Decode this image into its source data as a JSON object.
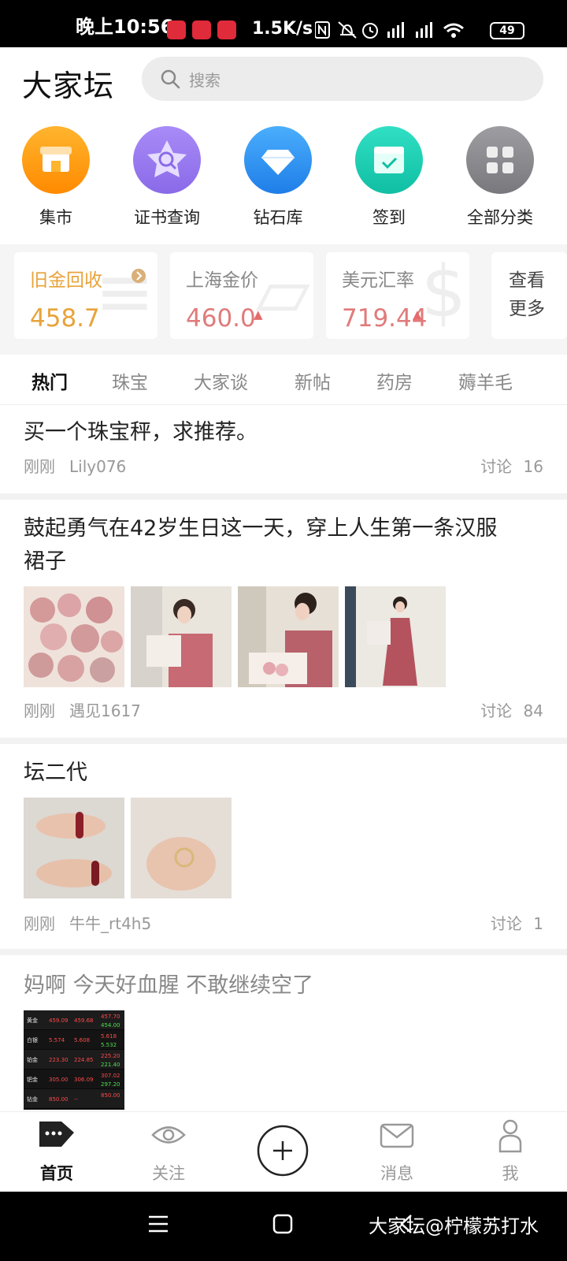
{
  "status_bar": {
    "time": "晚上10:56",
    "speed": "1.5K/s",
    "battery": "49",
    "icons": [
      "nfc-icon",
      "mute-icon",
      "alarm-icon",
      "signal-icon",
      "signal-icon",
      "wifi-icon"
    ]
  },
  "header": {
    "logo": "大家坛",
    "search_placeholder": "搜索"
  },
  "categories": [
    {
      "label": "集市",
      "icon": "shop-icon",
      "color": "#ff9f1c"
    },
    {
      "label": "证书查询",
      "icon": "certificate-search-icon",
      "color": "#9a7cf2"
    },
    {
      "label": "钻石库",
      "icon": "diamond-icon",
      "color": "#2b93f0"
    },
    {
      "label": "签到",
      "icon": "calendar-check-icon",
      "color": "#1ccfb4"
    },
    {
      "label": "全部分类",
      "icon": "grid-icon",
      "color": "#8c8c90"
    }
  ],
  "tickers": [
    {
      "name": "旧金回收",
      "value": "458.7",
      "value_color": "#e8a33a",
      "has_link": true
    },
    {
      "name": "上海金价",
      "value": "460.0",
      "value_color": "#e07b7b",
      "trend": "up"
    },
    {
      "name": "美元汇率",
      "value": "719.44",
      "value_color": "#e07b7b",
      "trend": "up"
    }
  ],
  "more_label": "查看更多",
  "more_line1": "查看",
  "more_line2": "更多",
  "tabs": [
    "热门",
    "珠宝",
    "大家谈",
    "新帖",
    "药房",
    "薅羊毛"
  ],
  "posts": [
    {
      "title": "买一个珠宝秤，求推荐。",
      "time": "刚刚",
      "author": "Lily076",
      "count_label": "讨论",
      "count": "16"
    },
    {
      "title_line1": "鼓起勇气在42岁生日这一天，穿上人生第一条汉服",
      "title_line2": "裙子",
      "time": "刚刚",
      "author": "遇见1617",
      "count_label": "讨论",
      "count": "84"
    },
    {
      "title": "坛二代",
      "time": "刚刚",
      "author": "牛牛_rt4h5",
      "count_label": "讨论",
      "count": "1"
    },
    {
      "title": "妈啊 今天好血腥 不敢继续空了"
    }
  ],
  "price_table": {
    "rows": [
      {
        "name": "黄金",
        "a": "459.09",
        "b": "459.68",
        "c1": "457.70",
        "c2": "454.00"
      },
      {
        "name": "白银",
        "a": "5.574",
        "b": "5.608",
        "c1": "5.618",
        "c2": "5.532"
      },
      {
        "name": "铂金",
        "a": "223.30",
        "b": "224.85",
        "c1": "225.20",
        "c2": "221.40"
      },
      {
        "name": "钯金",
        "a": "305.00",
        "b": "306.09",
        "c1": "307.02",
        "c2": "297.20"
      },
      {
        "name": "钻金",
        "a": "850.00",
        "b": "--",
        "c1": "850.00",
        "c2": ""
      }
    ]
  },
  "bottom_nav": [
    {
      "label": "首页",
      "icon": "home-icon",
      "active": true
    },
    {
      "label": "关注",
      "icon": "eye-icon"
    },
    {
      "label": "",
      "icon": "plus-icon"
    },
    {
      "label": "消息",
      "icon": "mail-icon"
    },
    {
      "label": "我",
      "icon": "person-icon"
    }
  ],
  "watermark": "大家坛@柠檬苏打水"
}
